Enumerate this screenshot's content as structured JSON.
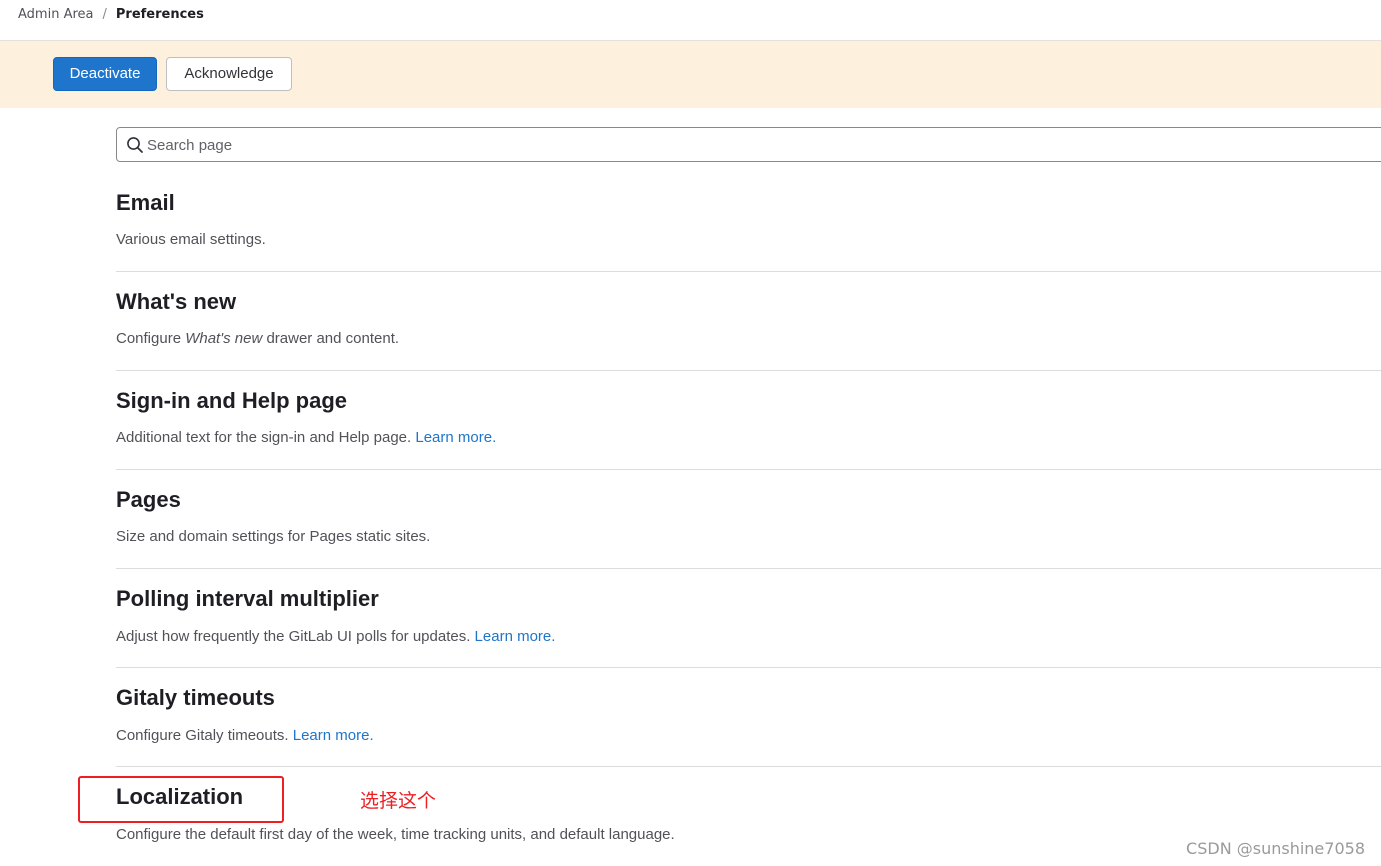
{
  "breadcrumb": {
    "parent": "Admin Area",
    "separator": "/",
    "current": "Preferences"
  },
  "banner": {
    "background": "#fdf1dd",
    "deactivate_label": "Deactivate",
    "acknowledge_label": "Acknowledge"
  },
  "search": {
    "placeholder": "Search page",
    "icon": "search-icon"
  },
  "sections": [
    {
      "title": "Email",
      "description": "Various email settings."
    },
    {
      "title": "What's new",
      "description_prefix": "Configure ",
      "description_em": "What's new",
      "description_suffix": " drawer and content."
    },
    {
      "title": "Sign-in and Help page",
      "description": "Additional text for the sign-in and Help page. ",
      "link": "Learn more."
    },
    {
      "title": "Pages",
      "description": "Size and domain settings for Pages static sites."
    },
    {
      "title": "Polling interval multiplier",
      "description": "Adjust how frequently the GitLab UI polls for updates. ",
      "link": "Learn more."
    },
    {
      "title": "Gitaly timeouts",
      "description": "Configure Gitaly timeouts. ",
      "link": "Learn more."
    },
    {
      "title": "Localization",
      "description": "Configure the default first day of the week, time tracking units, and default language."
    }
  ],
  "annotation": {
    "text": "选择这个",
    "color": "#ee1f23"
  },
  "watermark": "CSDN @sunshine7058",
  "colors": {
    "primary": "#1f75cb",
    "link": "#1f75cb"
  }
}
